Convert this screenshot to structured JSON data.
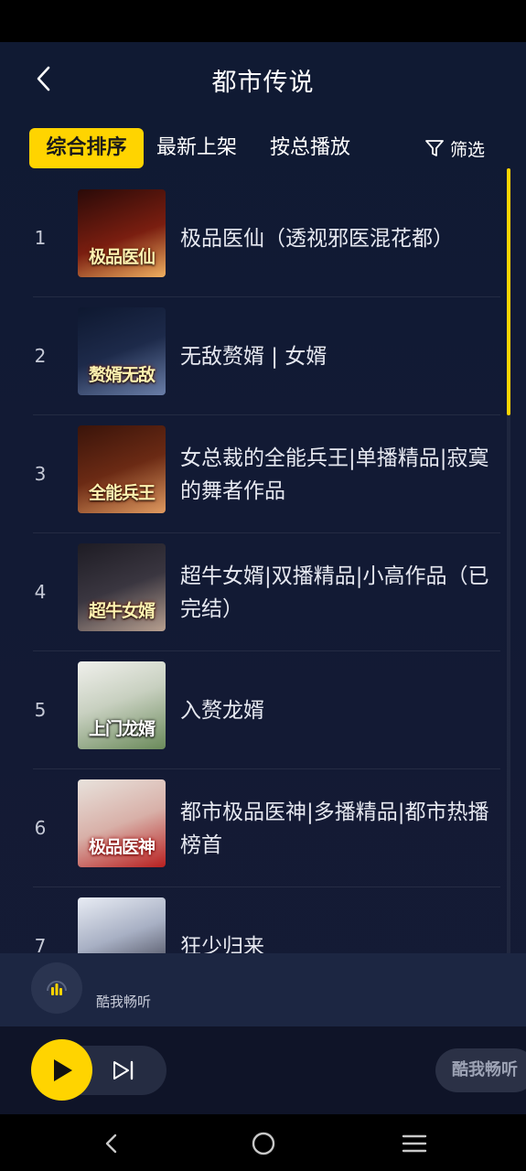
{
  "header": {
    "title": "都市传说"
  },
  "tabs": [
    {
      "label": "综合排序",
      "active": true
    },
    {
      "label": "最新上架",
      "active": false
    },
    {
      "label": "按总播放",
      "active": false
    }
  ],
  "filter": {
    "label": "筛选"
  },
  "list": [
    {
      "rank": "1",
      "title": "极品医仙（透视邪医混花都）",
      "cover_text": "极品医仙",
      "cover_colors": [
        "#7a1e10",
        "#f0b060"
      ]
    },
    {
      "rank": "2",
      "title": "无敌赘婿 | 女婿",
      "cover_text": "赘婿无敌",
      "cover_colors": [
        "#1d2a4a",
        "#6a7ea8"
      ]
    },
    {
      "rank": "3",
      "title": "女总裁的全能兵王|单播精品|寂寞的舞者作品",
      "cover_text": "全能兵王",
      "cover_colors": [
        "#6b2a14",
        "#e09a60"
      ]
    },
    {
      "rank": "4",
      "title": "超牛女婿|双播精品|小高作品（已完结）",
      "cover_text": "超牛女婿",
      "cover_colors": [
        "#3a3640",
        "#b8a090"
      ]
    },
    {
      "rank": "5",
      "title": "入赘龙婿",
      "cover_text": "上门龙婿",
      "cover_colors": [
        "#f0f0ec",
        "#6a8a5a"
      ]
    },
    {
      "rank": "6",
      "title": "都市极品医神|多播精品|都市热播榜首",
      "cover_text": "极品医神",
      "cover_colors": [
        "#e8e2dc",
        "#b82020"
      ]
    },
    {
      "rank": "7",
      "title": "狂少归来",
      "cover_text": "",
      "cover_colors": [
        "#d8dce8",
        "#2a2a38"
      ]
    }
  ],
  "mini_player": {
    "label": "酷我畅听"
  },
  "player": {
    "brand_label": "酷我畅听"
  },
  "colors": {
    "accent": "#ffd400",
    "background": "#111a33"
  }
}
